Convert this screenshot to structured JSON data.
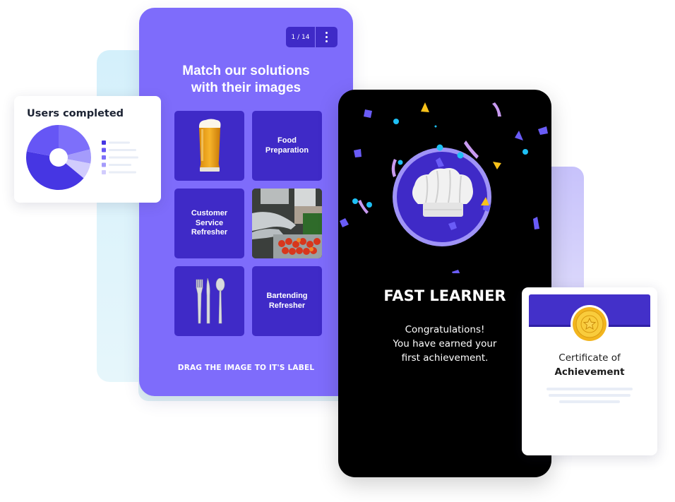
{
  "quiz_card": {
    "pager": "1 / 14",
    "menu_icon": "kebab-menu-icon",
    "title_line1": "Match our solutions",
    "title_line2": "with their images",
    "tiles": [
      {
        "type": "image",
        "icon": "beer-glass-image"
      },
      {
        "type": "label",
        "text": "Food Preparation"
      },
      {
        "type": "label",
        "text": "Customer Service Refresher"
      },
      {
        "type": "image",
        "icon": "food-prep-photo"
      },
      {
        "type": "image",
        "icon": "cutlery-image"
      },
      {
        "type": "label",
        "text": "Bartending Refresher"
      }
    ],
    "hint": "DRAG THE IMAGE TO IT'S LABEL",
    "colors": {
      "card": "#7e6cfb",
      "tile": "#3f2ac7"
    }
  },
  "users_card": {
    "title": "Users completed"
  },
  "chart_data": {
    "type": "pie",
    "title": "Users completed",
    "donut": true,
    "categories": [
      "",
      "",
      "",
      "",
      ""
    ],
    "values": [
      42,
      22,
      21,
      7,
      8
    ],
    "colors": [
      "#4636e3",
      "#6656f5",
      "#7d6ffa",
      "#a49bfb",
      "#d1ccfd"
    ],
    "legend_position": "right",
    "legend_labels_hidden": true
  },
  "achievement_card": {
    "badge_icon": "chef-hat-icon",
    "title": "FAST LEARNER",
    "message_line1": "Congratulations!",
    "message_line2": "You have earned your",
    "message_line3": "first achievement."
  },
  "certificate_card": {
    "seal_icon": "gold-star-seal-icon",
    "line1": "Certificate of",
    "line2": "Achievement"
  }
}
